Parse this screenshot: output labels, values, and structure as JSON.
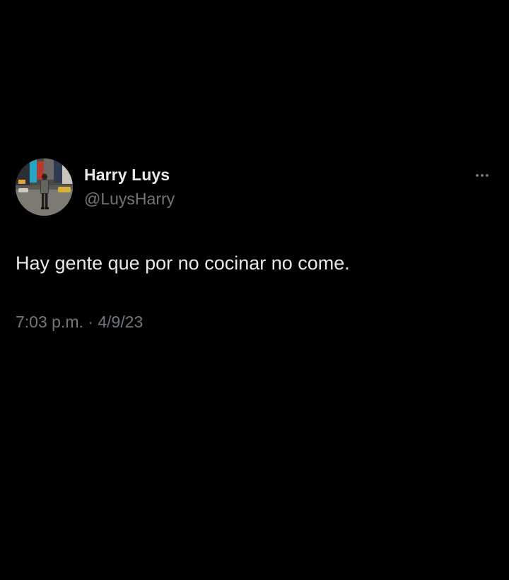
{
  "tweet": {
    "author": {
      "name": "Harry Luys",
      "handle": "@LuysHarry",
      "avatar_icon": "profile-photo-street"
    },
    "more_icon": "more-horizontal-icon",
    "text": "Hay gente que por no cocinar no come.",
    "time": "7:03 p.m.",
    "separator": "·",
    "date": "4/9/23"
  },
  "colors": {
    "background": "#000000",
    "primary_text": "#e7e9ea",
    "secondary_text": "#71767b"
  }
}
